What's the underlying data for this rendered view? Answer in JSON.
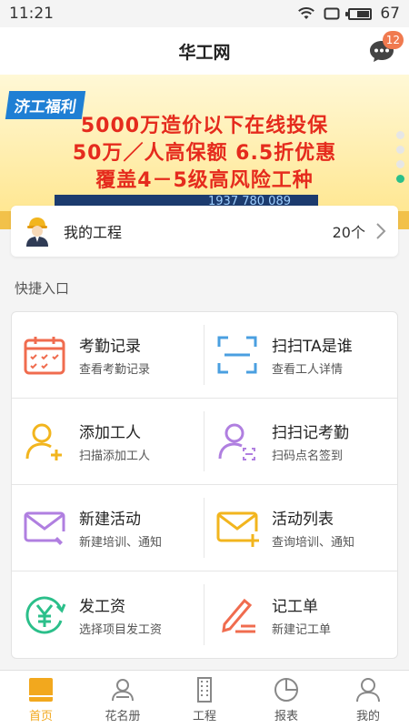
{
  "status_bar": {
    "time": "11:21",
    "battery": "67",
    "battery_level": 0.67
  },
  "header": {
    "title": "华工网",
    "message_badge": "12"
  },
  "banner": {
    "tag": "济工福利",
    "line1": "5000万造价以下在线投保",
    "line2": "50万／人高保额 6.5折优惠",
    "line3": "覆盖4－5级高风险工种",
    "strip": "1937 780 089",
    "dots": 4,
    "active_dot": 3
  },
  "project": {
    "label": "我的工程",
    "count": "20个"
  },
  "quick": {
    "title": "快捷入口",
    "items": [
      {
        "title": "考勤记录",
        "sub": "查看考勤记录",
        "icon": "calendar-icon"
      },
      {
        "title": "扫扫TA是谁",
        "sub": "查看工人详情",
        "icon": "scan-frame-icon"
      },
      {
        "title": "添加工人",
        "sub": "扫描添加工人",
        "icon": "add-user-icon"
      },
      {
        "title": "扫扫记考勤",
        "sub": "扫码点名签到",
        "icon": "scan-user-icon"
      },
      {
        "title": "新建活动",
        "sub": "新建培训、通知",
        "icon": "mail-edit-icon"
      },
      {
        "title": "活动列表",
        "sub": "查询培训、通知",
        "icon": "mail-add-icon"
      },
      {
        "title": "发工资",
        "sub": "选择项目发工资",
        "icon": "yuan-icon"
      },
      {
        "title": "记工单",
        "sub": "新建记工单",
        "icon": "pen-icon"
      }
    ]
  },
  "tabs": [
    {
      "label": "首页",
      "icon": "home-icon",
      "active": true
    },
    {
      "label": "花名册",
      "icon": "roster-icon",
      "active": false
    },
    {
      "label": "工程",
      "icon": "building-icon",
      "active": false
    },
    {
      "label": "报表",
      "icon": "pie-chart-icon",
      "active": false
    },
    {
      "label": "我的",
      "icon": "profile-icon",
      "active": false
    }
  ],
  "colors": {
    "accent": "#f2a81e",
    "badge": "#f07a4f",
    "banner_text": "#e52b1d"
  }
}
